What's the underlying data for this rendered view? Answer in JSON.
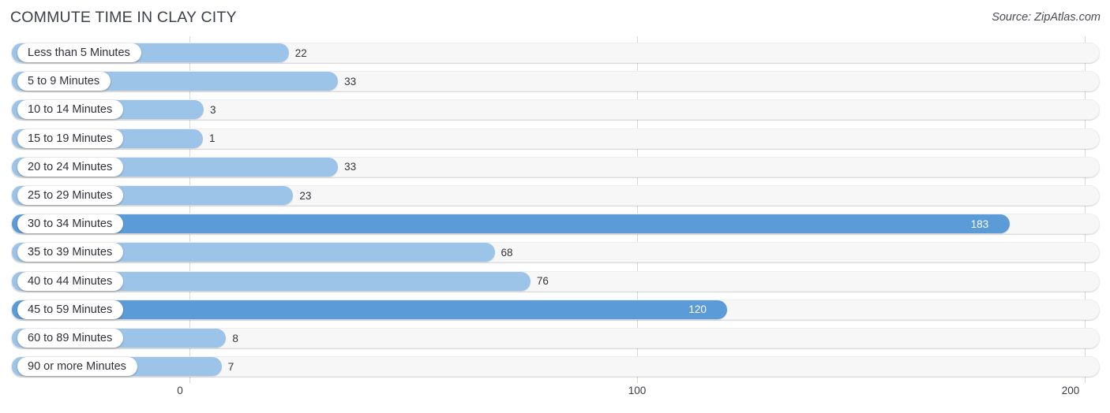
{
  "header": {
    "title": "COMMUTE TIME IN CLAY CITY",
    "source": "Source: ZipAtlas.com"
  },
  "colors": {
    "bar_light": "#9cc3e8",
    "bar_dark": "#5b9bd8",
    "track": "#f7f7f7",
    "gridline": "#d8d8d8",
    "text": "#33343c",
    "value_inside_text": "#ffffff"
  },
  "chart_data": {
    "type": "bar",
    "orientation": "horizontal",
    "title": "COMMUTE TIME IN CLAY CITY",
    "xlabel": "",
    "ylabel": "",
    "xlim": [
      0,
      200
    ],
    "ticks": [
      {
        "label": "0",
        "value": 0
      },
      {
        "label": "100",
        "value": 100
      },
      {
        "label": "200",
        "value": 200
      }
    ],
    "grid": true,
    "legend": false,
    "categories": [
      "Less than 5 Minutes",
      "5 to 9 Minutes",
      "10 to 14 Minutes",
      "15 to 19 Minutes",
      "20 to 24 Minutes",
      "25 to 29 Minutes",
      "30 to 34 Minutes",
      "35 to 39 Minutes",
      "40 to 44 Minutes",
      "45 to 59 Minutes",
      "60 to 89 Minutes",
      "90 or more Minutes"
    ],
    "values": [
      22,
      33,
      3,
      1,
      33,
      23,
      183,
      68,
      76,
      120,
      8,
      7
    ],
    "value_labels": [
      "22",
      "33",
      "3",
      "1",
      "33",
      "23",
      "183",
      "68",
      "76",
      "120",
      "8",
      "7"
    ],
    "highlighted": [
      false,
      false,
      false,
      false,
      false,
      false,
      true,
      false,
      false,
      true,
      false,
      false
    ]
  },
  "rows": [
    {
      "label": "Less than 5 Minutes",
      "value": 22,
      "value_label": "22",
      "highlight": false,
      "label_inside": false
    },
    {
      "label": "5 to 9 Minutes",
      "value": 33,
      "value_label": "33",
      "highlight": false,
      "label_inside": false
    },
    {
      "label": "10 to 14 Minutes",
      "value": 3,
      "value_label": "3",
      "highlight": false,
      "label_inside": false
    },
    {
      "label": "15 to 19 Minutes",
      "value": 1,
      "value_label": "1",
      "highlight": false,
      "label_inside": false
    },
    {
      "label": "20 to 24 Minutes",
      "value": 33,
      "value_label": "33",
      "highlight": false,
      "label_inside": false
    },
    {
      "label": "25 to 29 Minutes",
      "value": 23,
      "value_label": "23",
      "highlight": false,
      "label_inside": false
    },
    {
      "label": "30 to 34 Minutes",
      "value": 183,
      "value_label": "183",
      "highlight": true,
      "label_inside": true
    },
    {
      "label": "35 to 39 Minutes",
      "value": 68,
      "value_label": "68",
      "highlight": false,
      "label_inside": false
    },
    {
      "label": "40 to 44 Minutes",
      "value": 76,
      "value_label": "76",
      "highlight": false,
      "label_inside": false
    },
    {
      "label": "45 to 59 Minutes",
      "value": 120,
      "value_label": "120",
      "highlight": true,
      "label_inside": true
    },
    {
      "label": "60 to 89 Minutes",
      "value": 8,
      "value_label": "8",
      "highlight": false,
      "label_inside": false
    },
    {
      "label": "90 or more Minutes",
      "value": 7,
      "value_label": "7",
      "highlight": false,
      "label_inside": false
    }
  ]
}
